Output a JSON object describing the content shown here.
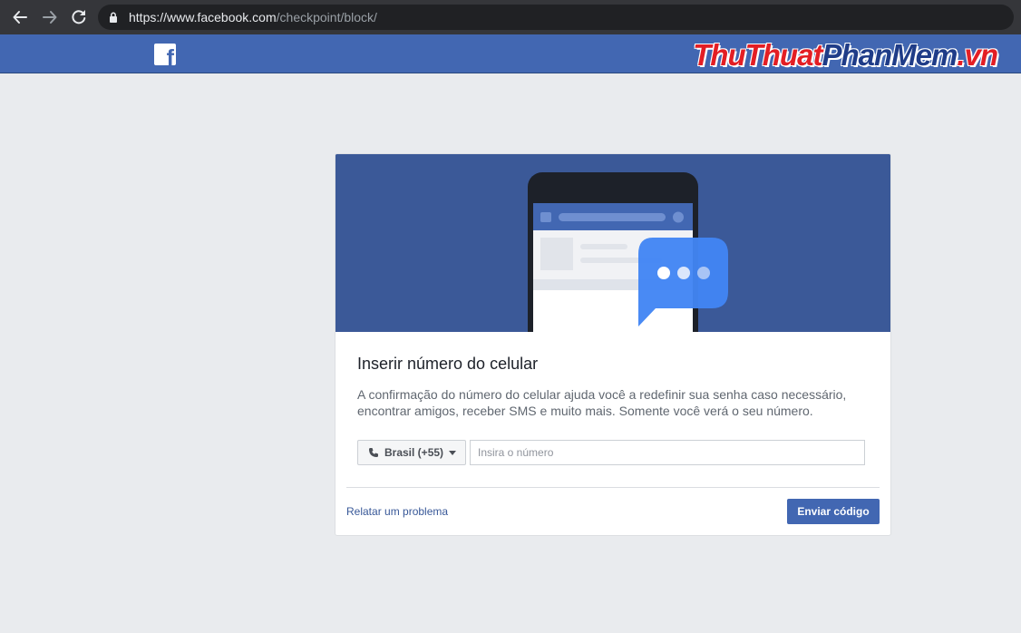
{
  "browser": {
    "url_host": "https://www.facebook.com",
    "url_path": "/checkpoint/block/"
  },
  "header": {
    "logo_letter": "f",
    "watermark_part1": "ThuThuat",
    "watermark_part2": "PhanMem",
    "watermark_part3": ".vn"
  },
  "card": {
    "title": "Inserir número do celular",
    "description": "A confirmação do número do celular ajuda você a redefinir sua senha caso necessário, encontrar amigos, receber SMS e muito mais. Somente você verá o seu número.",
    "country_selector": "Brasil (+55)",
    "phone_placeholder": "Insira o número",
    "phone_value": "",
    "report_link": "Relatar um problema",
    "submit_label": "Enviar código"
  },
  "colors": {
    "facebook_blue": "#4267b2",
    "hero_blue": "#3b5998",
    "bubble_blue": "#4285f4",
    "page_bg": "#e9ebee"
  },
  "icons": {
    "back": "arrow-left-icon",
    "forward": "arrow-right-icon",
    "reload": "reload-icon",
    "lock": "lock-icon",
    "phone": "phone-icon",
    "caret": "caret-down-icon",
    "chat": "chat-bubble-icon"
  }
}
